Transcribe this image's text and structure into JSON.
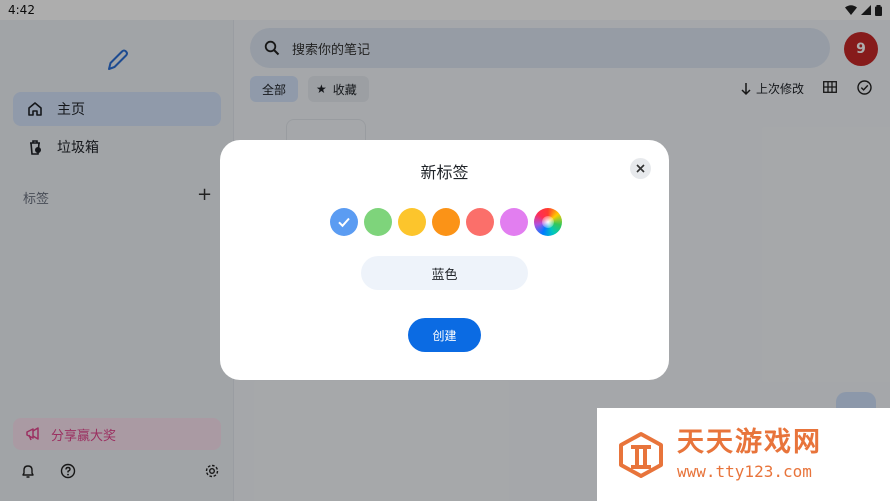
{
  "status": {
    "time": "4:42"
  },
  "sidebar": {
    "items": [
      {
        "label": "主页",
        "icon": "home-icon",
        "active": true
      },
      {
        "label": "垃圾箱",
        "icon": "trash-icon",
        "active": false
      }
    ],
    "tags_label": "标签",
    "promo_label": "分享赢大奖"
  },
  "search": {
    "placeholder": "搜索你的笔记"
  },
  "avatar": {
    "initial": "9",
    "color": "#c62828"
  },
  "filters": {
    "all_label": "全部",
    "fav_label": "收藏"
  },
  "sort": {
    "label": "上次修改"
  },
  "dialog": {
    "title": "新标签",
    "colors": [
      {
        "name": "blue",
        "hex": "#5b9cf2",
        "selected": true
      },
      {
        "name": "green",
        "hex": "#7ed47b",
        "selected": false
      },
      {
        "name": "yellow",
        "hex": "#fcc52c",
        "selected": false
      },
      {
        "name": "orange",
        "hex": "#fb9317",
        "selected": false
      },
      {
        "name": "red",
        "hex": "#fb6f6a",
        "selected": false
      },
      {
        "name": "purple",
        "hex": "#e27ef0",
        "selected": false
      },
      {
        "name": "custom",
        "hex": "rainbow",
        "selected": false
      }
    ],
    "name_value": "蓝色",
    "create_label": "创建"
  },
  "watermark": {
    "title": "天天游戏网",
    "url": "www.tty123.com"
  }
}
